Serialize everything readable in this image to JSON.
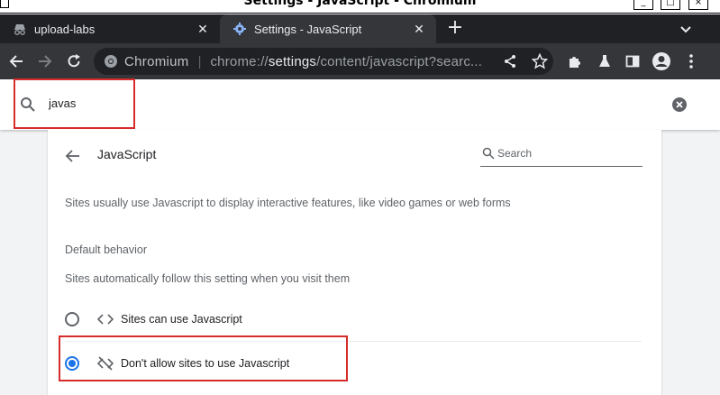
{
  "window": {
    "title": "Settings - JavaScript - Chromium",
    "buttons": {
      "minimize": "_",
      "maximize": "□",
      "close": "×"
    }
  },
  "tabs": [
    {
      "label": "upload-labs",
      "icon": "incognito-icon",
      "active": false
    },
    {
      "label": "Settings - JavaScript",
      "icon": "gear-icon",
      "active": true
    }
  ],
  "newtab": {
    "label": "+"
  },
  "toolbar": {
    "site_name": "Chromium",
    "url_scheme": "chrome://",
    "url_host": "settings",
    "url_path": "/content/javascript?searc..."
  },
  "settings_search": {
    "value": "javas"
  },
  "page": {
    "title": "JavaScript",
    "search_placeholder": "Search",
    "description": "Sites usually use Javascript to display interactive features, like video games or web forms",
    "default_behavior_heading": "Default behavior",
    "default_behavior_sub": "Sites automatically follow this setting when you visit them",
    "options": [
      {
        "label": "Sites can use Javascript",
        "icon": "code-icon",
        "selected": false
      },
      {
        "label": "Don't allow sites to use Javascript",
        "icon": "code-off-icon",
        "selected": true
      }
    ]
  },
  "colors": {
    "tabstrip": "#202124",
    "toolbar": "#35363a",
    "accent": "#1a73e8",
    "highlight": "#d62c2c"
  }
}
